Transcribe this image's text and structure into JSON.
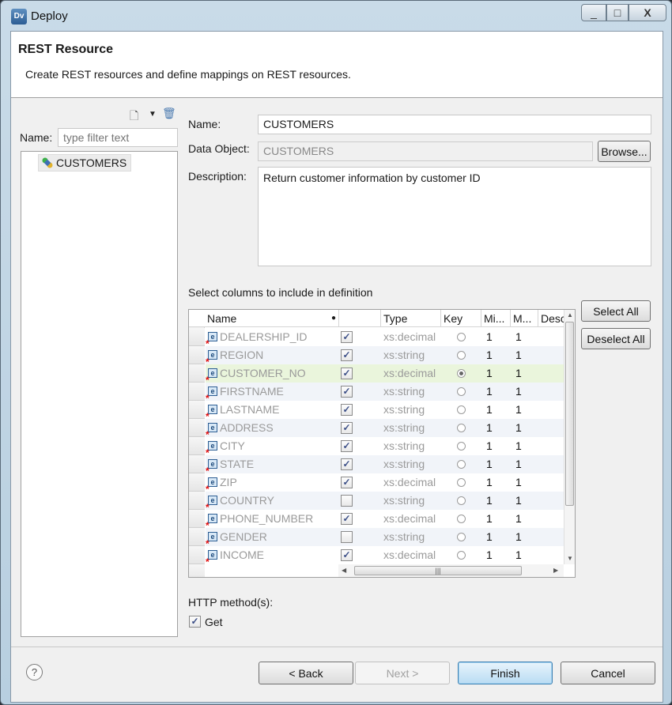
{
  "window": {
    "title": "Deploy",
    "app_icon_text": "Dv",
    "minimize_glyph": "_",
    "maximize_glyph": "□",
    "close_glyph": "X"
  },
  "header": {
    "title": "REST Resource",
    "description": "Create REST resources and define mappings on REST resources."
  },
  "left_panel": {
    "name_label": "Name:",
    "filter_placeholder": "type filter text",
    "new_glyph": "🗋",
    "dropdown_glyph": "▼",
    "delete_glyph": "🗑",
    "tree_items": [
      {
        "label": "CUSTOMERS"
      }
    ]
  },
  "form": {
    "name_label": "Name:",
    "name_value": "CUSTOMERS",
    "data_object_label": "Data Object:",
    "data_object_value": "CUSTOMERS",
    "browse_label": "Browse...",
    "description_label": "Description:",
    "description_value": "Return customer information by customer ID"
  },
  "columns_section": {
    "label": "Select columns to include in definition",
    "select_all_label": "Select All",
    "deselect_all_label": "Deselect All",
    "headers": [
      "Name",
      "",
      "Type",
      "Key",
      "Mi...",
      "M...",
      "Desc"
    ],
    "rows": [
      {
        "name": "DEALERSHIP_ID",
        "included": true,
        "type": "xs:decimal",
        "key": false,
        "min": "1",
        "max": "1"
      },
      {
        "name": "REGION",
        "included": true,
        "type": "xs:string",
        "key": false,
        "min": "1",
        "max": "1"
      },
      {
        "name": "CUSTOMER_NO",
        "included": true,
        "type": "xs:decimal",
        "key": true,
        "min": "1",
        "max": "1"
      },
      {
        "name": "FIRSTNAME",
        "included": true,
        "type": "xs:string",
        "key": false,
        "min": "1",
        "max": "1"
      },
      {
        "name": "LASTNAME",
        "included": true,
        "type": "xs:string",
        "key": false,
        "min": "1",
        "max": "1"
      },
      {
        "name": "ADDRESS",
        "included": true,
        "type": "xs:string",
        "key": false,
        "min": "1",
        "max": "1"
      },
      {
        "name": "CITY",
        "included": true,
        "type": "xs:string",
        "key": false,
        "min": "1",
        "max": "1"
      },
      {
        "name": "STATE",
        "included": true,
        "type": "xs:string",
        "key": false,
        "min": "1",
        "max": "1"
      },
      {
        "name": "ZIP",
        "included": true,
        "type": "xs:decimal",
        "key": false,
        "min": "1",
        "max": "1"
      },
      {
        "name": "COUNTRY",
        "included": false,
        "type": "xs:string",
        "key": false,
        "min": "1",
        "max": "1"
      },
      {
        "name": "PHONE_NUMBER",
        "included": true,
        "type": "xs:decimal",
        "key": false,
        "min": "1",
        "max": "1"
      },
      {
        "name": "GENDER",
        "included": false,
        "type": "xs:string",
        "key": false,
        "min": "1",
        "max": "1"
      },
      {
        "name": "INCOME",
        "included": true,
        "type": "xs:decimal",
        "key": false,
        "min": "1",
        "max": "1"
      }
    ]
  },
  "http": {
    "label": "HTTP method(s):",
    "methods": [
      {
        "label": "Get",
        "checked": true
      }
    ]
  },
  "footer": {
    "help_glyph": "?",
    "back_label": "< Back",
    "next_label": "Next >",
    "finish_label": "Finish",
    "cancel_label": "Cancel"
  }
}
